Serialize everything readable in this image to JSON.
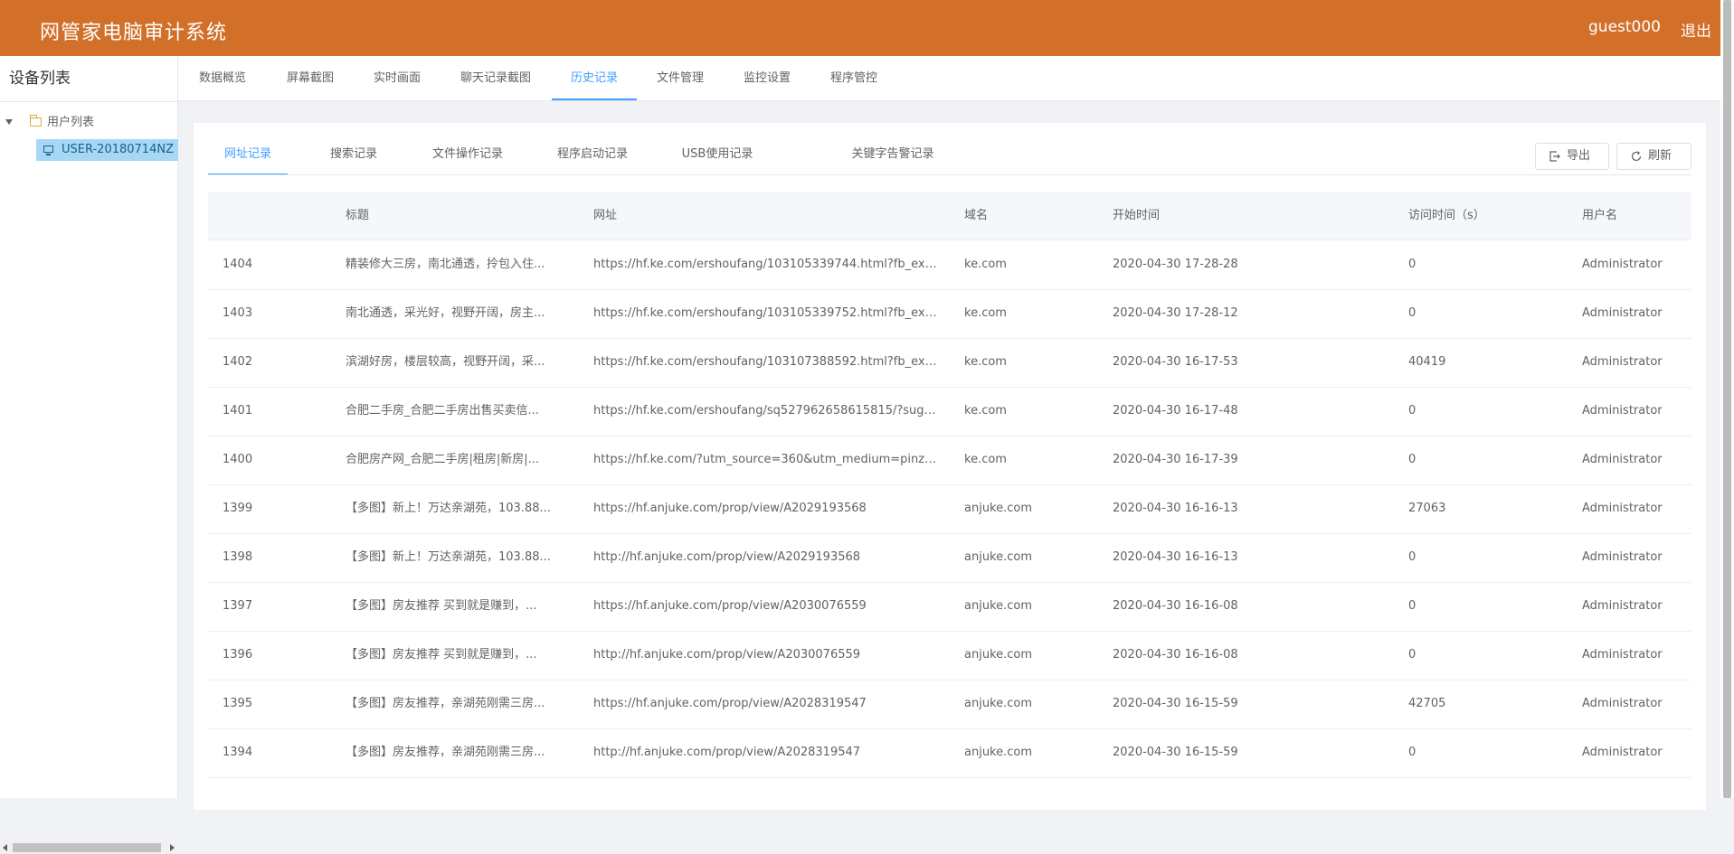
{
  "header": {
    "title": "网管家电脑审计系统",
    "username": "guest000",
    "logout_label": "退出"
  },
  "sidebar": {
    "title": "设备列表",
    "tree_root_label": "用户列表",
    "device_label": "USER-20180714NZ"
  },
  "topnav": [
    {
      "label": "数据概览"
    },
    {
      "label": "屏幕截图"
    },
    {
      "label": "实时画面"
    },
    {
      "label": "聊天记录截图"
    },
    {
      "label": "历史记录",
      "active": true
    },
    {
      "label": "文件管理"
    },
    {
      "label": "监控设置"
    },
    {
      "label": "程序管控"
    }
  ],
  "subtabs": [
    {
      "label": "网址记录",
      "active": true
    },
    {
      "label": "搜索记录"
    },
    {
      "label": "文件操作记录"
    },
    {
      "label": "程序启动记录"
    },
    {
      "label": "USB使用记录"
    },
    {
      "label": "关键字告警记录"
    }
  ],
  "actions": {
    "export_label": "导出",
    "refresh_label": "刷新"
  },
  "table": {
    "columns": [
      "标题",
      "网址",
      "域名",
      "开始时间",
      "访问时间（s）",
      "用户名"
    ],
    "rows": [
      {
        "id": "1404",
        "title": "精装修大三房，南北通透，拎包入住...",
        "url": "https://hf.ke.com/ershoufang/103105339744.html?fb_exp...",
        "domain": "ke.com",
        "start": "2020-04-30 17-28-28",
        "duration": "0",
        "user": "Administrator"
      },
      {
        "id": "1403",
        "title": "南北通透，采光好，视野开阔，房主...",
        "url": "https://hf.ke.com/ershoufang/103105339752.html?fb_exp...",
        "domain": "ke.com",
        "start": "2020-04-30 17-28-12",
        "duration": "0",
        "user": "Administrator"
      },
      {
        "id": "1402",
        "title": "滨湖好房，楼层较高，视野开阔，采...",
        "url": "https://hf.ke.com/ershoufang/103107388592.html?fb_exp...",
        "domain": "ke.com",
        "start": "2020-04-30 16-17-53",
        "duration": "40419",
        "user": "Administrator"
      },
      {
        "id": "1401",
        "title": "合肥二手房_合肥二手房出售买卖信...",
        "url": "https://hf.ke.com/ershoufang/sq527962658615815/?sug=...",
        "domain": "ke.com",
        "start": "2020-04-30 16-17-48",
        "duration": "0",
        "user": "Administrator"
      },
      {
        "id": "1400",
        "title": "合肥房产网_合肥二手房|租房|新房|...",
        "url": "https://hf.ke.com/?utm_source=360&utm_medium=pinzh...",
        "domain": "ke.com",
        "start": "2020-04-30 16-17-39",
        "duration": "0",
        "user": "Administrator"
      },
      {
        "id": "1399",
        "title": "【多图】新上！万达亲湖苑，103.88...",
        "url": "https://hf.anjuke.com/prop/view/A2029193568",
        "domain": "anjuke.com",
        "start": "2020-04-30 16-16-13",
        "duration": "27063",
        "user": "Administrator"
      },
      {
        "id": "1398",
        "title": "【多图】新上！万达亲湖苑，103.88...",
        "url": "http://hf.anjuke.com/prop/view/A2029193568",
        "domain": "anjuke.com",
        "start": "2020-04-30 16-16-13",
        "duration": "0",
        "user": "Administrator"
      },
      {
        "id": "1397",
        "title": "【多图】房友推荐 买到就是赚到，...",
        "url": "https://hf.anjuke.com/prop/view/A2030076559",
        "domain": "anjuke.com",
        "start": "2020-04-30 16-16-08",
        "duration": "0",
        "user": "Administrator"
      },
      {
        "id": "1396",
        "title": "【多图】房友推荐 买到就是赚到，...",
        "url": "http://hf.anjuke.com/prop/view/A2030076559",
        "domain": "anjuke.com",
        "start": "2020-04-30 16-16-08",
        "duration": "0",
        "user": "Administrator"
      },
      {
        "id": "1395",
        "title": "【多图】房友推荐，亲湖苑刚需三房...",
        "url": "https://hf.anjuke.com/prop/view/A2028319547",
        "domain": "anjuke.com",
        "start": "2020-04-30 16-15-59",
        "duration": "42705",
        "user": "Administrator"
      },
      {
        "id": "1394",
        "title": "【多图】房友推荐，亲湖苑刚需三房...",
        "url": "http://hf.anjuke.com/prop/view/A2028319547",
        "domain": "anjuke.com",
        "start": "2020-04-30 16-15-59",
        "duration": "0",
        "user": "Administrator"
      }
    ]
  },
  "colors": {
    "header_bg": "#d2702a",
    "accent": "#409eff",
    "selected_bg": "#a6d8f5"
  }
}
